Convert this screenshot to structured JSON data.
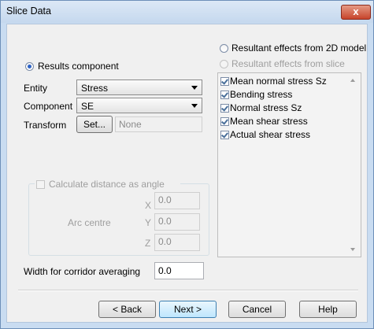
{
  "window": {
    "title": "Slice Data",
    "close_label": "x"
  },
  "left": {
    "results_component_label": "Results component",
    "entity_label": "Entity",
    "entity_value": "Stress",
    "component_label": "Component",
    "component_value": "SE",
    "transform_label": "Transform",
    "transform_button": "Set...",
    "transform_value": "None",
    "calc_angle_label": "Calculate distance as angle",
    "arc_centre_label": "Arc centre",
    "x_label": "X",
    "y_label": "Y",
    "z_label": "Z",
    "x_value": "0.0",
    "y_value": "0.0",
    "z_value": "0.0",
    "corridor_label": "Width for corridor averaging",
    "corridor_value": "0.0"
  },
  "right": {
    "option_2d_model": "Resultant effects from 2D model",
    "option_slice": "Resultant effects from slice",
    "effects": [
      {
        "label": "Mean normal stress Sz",
        "checked": true
      },
      {
        "label": "Bending stress",
        "checked": true
      },
      {
        "label": "Normal stress Sz",
        "checked": true
      },
      {
        "label": "Mean shear stress",
        "checked": true
      },
      {
        "label": "Actual shear stress",
        "checked": true
      }
    ]
  },
  "buttons": {
    "back": "< Back",
    "next": "Next >",
    "cancel": "Cancel",
    "help": "Help"
  }
}
